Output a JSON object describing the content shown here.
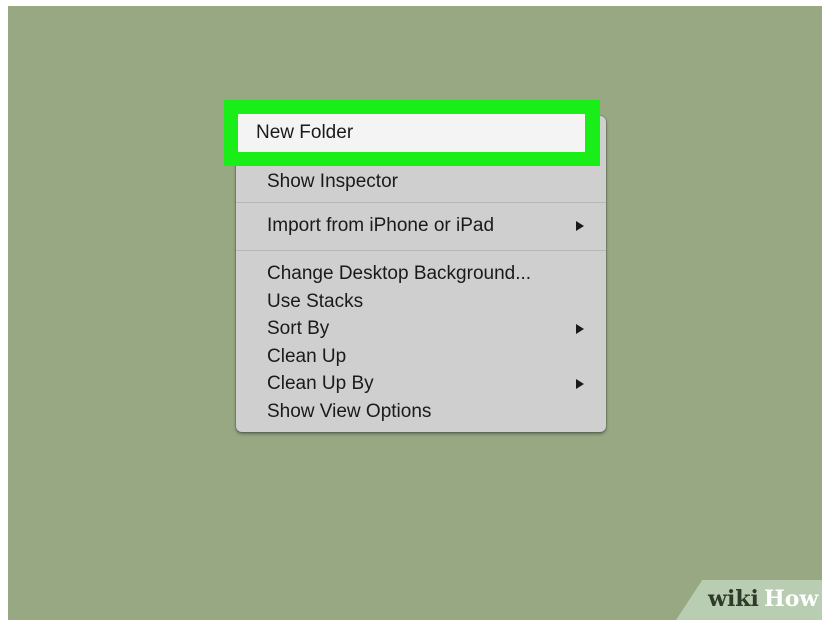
{
  "context_menu": {
    "items": [
      {
        "label": "New Folder",
        "has_submenu": false,
        "highlighted": true
      },
      {
        "label": "Show Inspector",
        "has_submenu": false
      },
      {
        "label": "Import from iPhone or iPad",
        "has_submenu": true
      },
      {
        "label": "Change Desktop Background...",
        "has_submenu": false
      },
      {
        "label": "Use Stacks",
        "has_submenu": false
      },
      {
        "label": "Sort By",
        "has_submenu": true
      },
      {
        "label": "Clean Up",
        "has_submenu": false
      },
      {
        "label": "Clean Up By",
        "has_submenu": true
      },
      {
        "label": "Show View Options",
        "has_submenu": false
      }
    ]
  },
  "watermark": {
    "part1": "wiki",
    "part2": "How"
  },
  "colors": {
    "desktop_background": "#97a883",
    "menu_background": "#cfcfcf",
    "highlight_outline": "#19ee19",
    "highlight_fill": "#f4f4f4"
  }
}
